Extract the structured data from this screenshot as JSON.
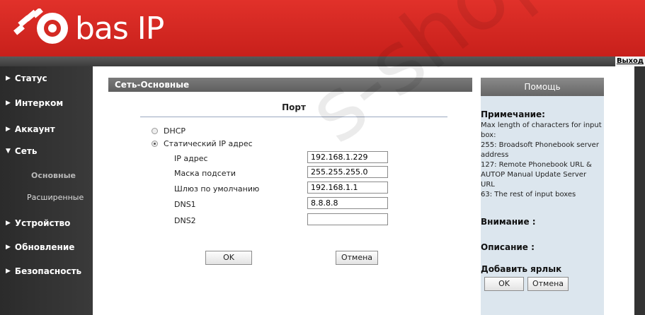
{
  "brand": {
    "logo_text": "bas IP"
  },
  "topbar": {
    "logout": "Выход"
  },
  "sidebar": {
    "items": [
      {
        "label": "Статус",
        "arrow": "▶"
      },
      {
        "label": "Интерком",
        "arrow": "▶"
      },
      {
        "label": "Аккаунт",
        "arrow": "▶"
      },
      {
        "label": "Сеть",
        "arrow": "▼"
      },
      {
        "label": "Устройство",
        "arrow": "▶"
      },
      {
        "label": "Обновление",
        "arrow": "▶"
      },
      {
        "label": "Безопасность",
        "arrow": "▶"
      }
    ],
    "sub_items": [
      {
        "label": "Основные",
        "active": true
      },
      {
        "label": "Расширенные",
        "active": false
      }
    ]
  },
  "main": {
    "panel_title": "Сеть-Основные",
    "section_title": "Порт",
    "radios": [
      {
        "label": "DHCP",
        "checked": false
      },
      {
        "label": "Статический IP адрес",
        "checked": true
      }
    ],
    "fields": [
      {
        "label": "IP адрес",
        "value": "192.168.1.229"
      },
      {
        "label": "Маска подсети",
        "value": "255.255.255.0"
      },
      {
        "label": "Шлюз по умолчанию",
        "value": "192.168.1.1"
      },
      {
        "label": "DNS1",
        "value": "8.8.8.8"
      },
      {
        "label": "DNS2",
        "value": ""
      }
    ],
    "ok_label": "OK",
    "cancel_label": "Отмена"
  },
  "help": {
    "title": "Помощь",
    "note_title": "Примечание:",
    "note_lines": [
      "Max length of characters for input box:",
      "255: Broadsoft Phonebook server address",
      "127: Remote Phonebook URL & AUTOP Manual Update Server URL",
      "63: The rest of input boxes"
    ],
    "attention_title": "Внимание :",
    "description_title": "Описание :",
    "shortcut_title": "Добавить ярлык",
    "ok_label": "OK",
    "cancel_label": "Отмена"
  },
  "colors": {
    "brand_red": "#d42a23",
    "sidebar_bg": "#333333",
    "help_bg": "#dce6ee"
  },
  "watermark": "s-shop.com"
}
